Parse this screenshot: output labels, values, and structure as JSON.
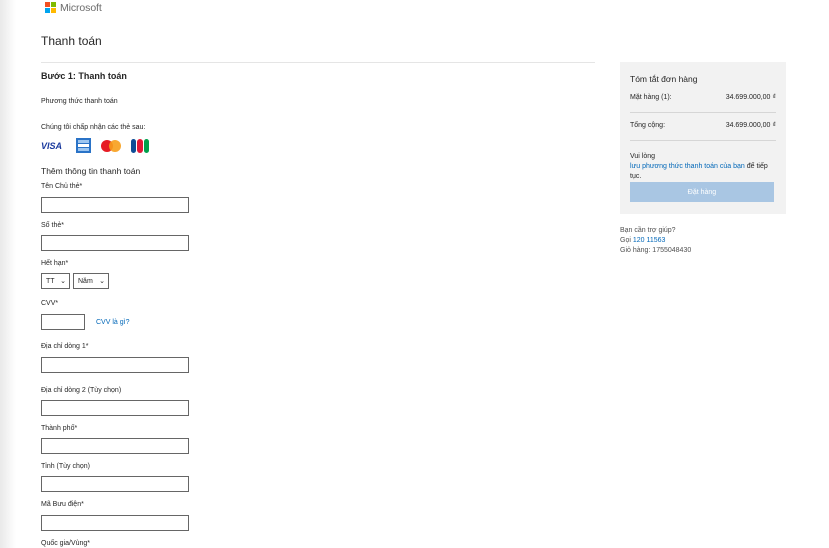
{
  "header": {
    "logo_text": "Microsoft"
  },
  "page": {
    "title": "Thanh toán"
  },
  "step": {
    "title": "Bước 1: Thanh toán",
    "payment_method_label": "Phương thức thanh toán",
    "accept_text": "Chúng tôi chấp nhận các thẻ sau:",
    "cards": [
      "VISA",
      "AMEX",
      "Mastercard",
      "JCB"
    ],
    "add_info_label": "Thêm thông tin thanh toán"
  },
  "form": {
    "cardholder_label": "Tên Chủ thẻ*",
    "card_number_label": "Số thẻ*",
    "expiry_label": "Hết hạn*",
    "expiry_month": "TT",
    "expiry_year": "Năm",
    "cvv_label": "CVV*",
    "cvv_help_link": "CVV là gì?",
    "address1_label": "Địa chỉ dòng 1*",
    "address2_label": "Địa chỉ dòng 2 (Tùy chọn)",
    "city_label": "Thành phố*",
    "province_label": "Tỉnh (Tùy chọn)",
    "postal_label": "Mã Bưu điện*",
    "country_label": "Quốc gia/Vùng*"
  },
  "summary": {
    "title": "Tóm tắt đơn hàng",
    "items_label": "Mặt hàng (1):",
    "items_value": "34.699.000,00 ₫",
    "total_label": "Tổng cộng:",
    "total_value": "34.699.000,00 ₫",
    "note_prefix": "Vui lòng",
    "note_link": "lưu phương thức thanh toán của bạn",
    "note_suffix": "để tiếp tục.",
    "order_button": "Đặt hàng"
  },
  "help": {
    "question": "Bạn cần trợ giúp?",
    "call_label": "Gọi",
    "phone": "120 11563",
    "cart_label": "Giỏ hàng: 1755048430"
  },
  "colors": {
    "accent": "#0067b8",
    "button_disabled": "#a9c6e3",
    "summary_bg": "#f2f2f2"
  }
}
